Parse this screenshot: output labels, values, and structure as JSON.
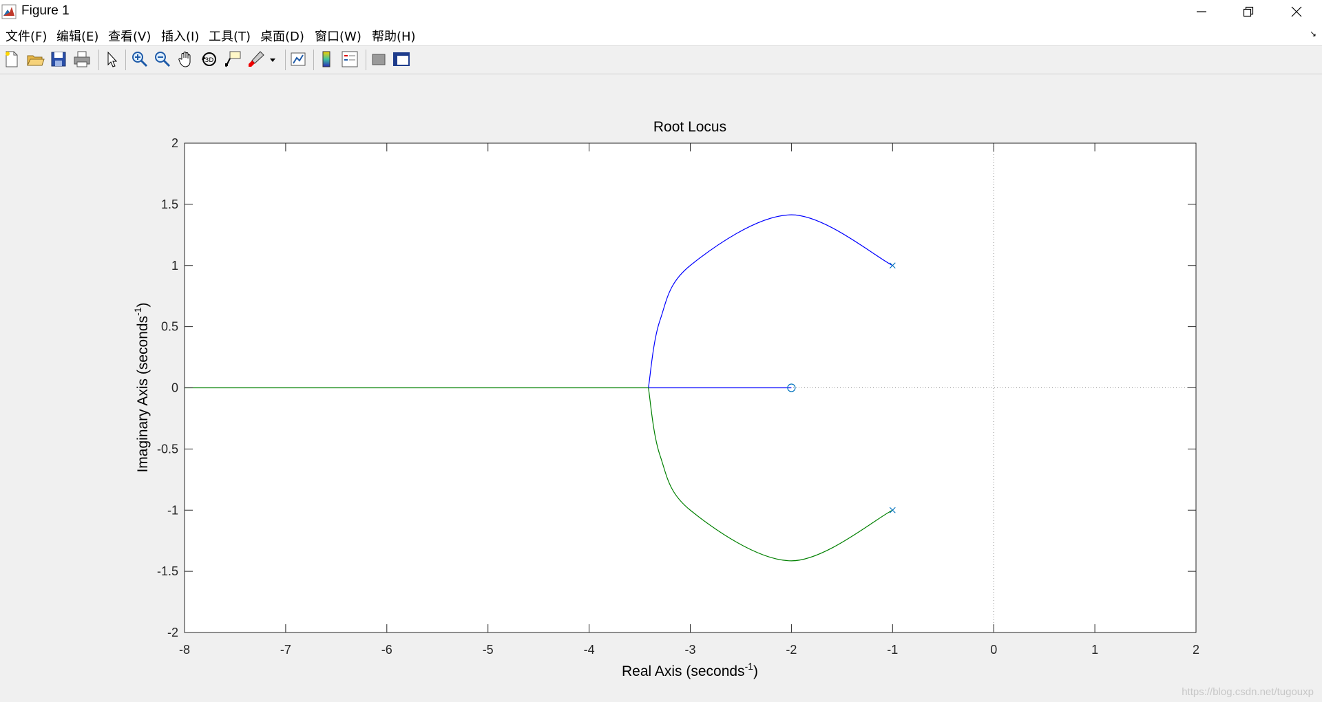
{
  "window": {
    "title": "Figure 1",
    "minimize_icon": "minimize-icon",
    "restore_icon": "restore-icon",
    "close_icon": "close-icon"
  },
  "menu": {
    "items": [
      "文件(F)",
      "编辑(E)",
      "查看(V)",
      "插入(I)",
      "工具(T)",
      "桌面(D)",
      "窗口(W)",
      "帮助(H)"
    ]
  },
  "toolbar": {
    "icons": [
      "new-figure-icon",
      "open-file-icon",
      "save-icon",
      "print-icon",
      "pointer-icon",
      "zoom-in-icon",
      "zoom-out-icon",
      "pan-hand-icon",
      "rotate-3d-icon",
      "data-cursor-icon",
      "brush-icon",
      "link-plot-icon",
      "colorbar-icon",
      "legend-icon",
      "hide-plot-tools-icon",
      "show-plot-tools-icon"
    ]
  },
  "chart_data": {
    "type": "line",
    "title": "Root Locus",
    "xlabel": "Real Axis (seconds",
    "ylabel": "Imaginary Axis (seconds",
    "label_exponent": "-1",
    "label_close": ")",
    "xlim": [
      -8,
      2
    ],
    "ylim": [
      -2,
      2
    ],
    "xticks": [
      "-8",
      "-7",
      "-6",
      "-5",
      "-4",
      "-3",
      "-2",
      "-1",
      "0",
      "1",
      "2"
    ],
    "yticks": [
      "-2",
      "-1.5",
      "-1",
      "-0.5",
      "0",
      "0.5",
      "1",
      "1.5",
      "2"
    ],
    "grid": false,
    "reference_lines": {
      "x0_dotted": true,
      "y0_dotted": true
    },
    "series": [
      {
        "color": "#0000ff",
        "points": [
          [
            -1,
            1
          ],
          [
            -2,
            1.414
          ],
          [
            -3,
            1
          ],
          [
            -3.3,
            0.55
          ],
          [
            -3.414,
            0
          ],
          [
            -2,
            0
          ]
        ]
      },
      {
        "color": "#008000",
        "points": [
          [
            -1,
            -1
          ],
          [
            -2,
            -1.414
          ],
          [
            -3,
            -1
          ],
          [
            -3.3,
            -0.55
          ],
          [
            -3.414,
            0
          ],
          [
            -8,
            0
          ]
        ]
      }
    ],
    "poles": [
      [
        -1,
        1
      ],
      [
        -1,
        -1
      ]
    ],
    "zeros": [
      [
        -2,
        0
      ]
    ],
    "marker_color": "#0072bd"
  },
  "watermark": "https://blog.csdn.net/tugouxp"
}
